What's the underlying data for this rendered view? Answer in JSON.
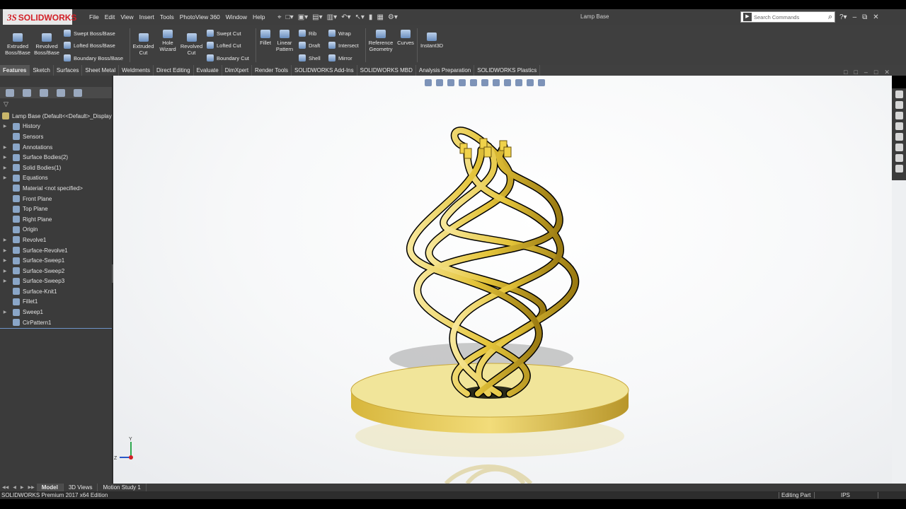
{
  "app": {
    "logo_ds": "3S",
    "logo_text": "SOLIDWORKS",
    "document_title": "Lamp Base"
  },
  "menu": [
    "File",
    "Edit",
    "View",
    "Insert",
    "Tools",
    "PhotoView 360",
    "Window",
    "Help"
  ],
  "search": {
    "placeholder": "Search Commands"
  },
  "ribbon": {
    "extruded_boss": "Extruded Boss/Base",
    "revolved_boss": "Revolved Boss/Base",
    "swept_boss": "Swept Boss/Base",
    "lofted_boss": "Lofted Boss/Base",
    "boundary_boss": "Boundary Boss/Base",
    "extruded_cut": "Extruded Cut",
    "hole_wizard": "Hole Wizard",
    "revolved_cut": "Revolved Cut",
    "swept_cut": "Swept Cut",
    "lofted_cut": "Lofted Cut",
    "boundary_cut": "Boundary Cut",
    "fillet": "Fillet",
    "linear_pattern": "Linear Pattern",
    "rib": "Rib",
    "draft": "Draft",
    "shell": "Shell",
    "wrap": "Wrap",
    "intersect": "Intersect",
    "mirror": "Mirror",
    "reference_geometry": "Reference Geometry",
    "curves": "Curves",
    "instant3d": "Instant3D"
  },
  "command_tabs": [
    "Features",
    "Sketch",
    "Surfaces",
    "Sheet Metal",
    "Weldments",
    "Direct Editing",
    "Evaluate",
    "DimXpert",
    "Render Tools",
    "SOLIDWORKS Add-Ins",
    "SOLIDWORKS MBD",
    "Analysis Preparation",
    "SOLIDWORKS Plastics"
  ],
  "tree": {
    "root": "Lamp Base  (Default<<Default>_Display",
    "items": [
      {
        "label": "History",
        "expandable": true,
        "icon": "history-icon"
      },
      {
        "label": "Sensors",
        "expandable": false,
        "icon": "sensor-icon"
      },
      {
        "label": "Annotations",
        "expandable": true,
        "icon": "annotation-icon"
      },
      {
        "label": "Surface Bodies(2)",
        "expandable": true,
        "icon": "surface-bodies-icon"
      },
      {
        "label": "Solid Bodies(1)",
        "expandable": true,
        "icon": "solid-bodies-icon"
      },
      {
        "label": "Equations",
        "expandable": true,
        "icon": "equations-icon"
      },
      {
        "label": "Material <not specified>",
        "expandable": false,
        "icon": "material-icon"
      },
      {
        "label": "Front Plane",
        "expandable": false,
        "icon": "plane-icon"
      },
      {
        "label": "Top Plane",
        "expandable": false,
        "icon": "plane-icon"
      },
      {
        "label": "Right Plane",
        "expandable": false,
        "icon": "plane-icon"
      },
      {
        "label": "Origin",
        "expandable": false,
        "icon": "origin-icon"
      },
      {
        "label": "Revolve1",
        "expandable": true,
        "icon": "revolve-icon"
      },
      {
        "label": "Surface-Revolve1",
        "expandable": true,
        "icon": "surface-revolve-icon"
      },
      {
        "label": "Surface-Sweep1",
        "expandable": true,
        "icon": "surface-sweep-icon"
      },
      {
        "label": "Surface-Sweep2",
        "expandable": true,
        "icon": "surface-sweep-icon"
      },
      {
        "label": "Surface-Sweep3",
        "expandable": true,
        "icon": "surface-sweep-icon"
      },
      {
        "label": "Surface-Knit1",
        "expandable": false,
        "icon": "surface-knit-icon"
      },
      {
        "label": "Fillet1",
        "expandable": false,
        "icon": "fillet-icon"
      },
      {
        "label": "Sweep1",
        "expandable": true,
        "icon": "sweep-icon"
      },
      {
        "label": "CirPattern1",
        "expandable": false,
        "icon": "circular-pattern-icon"
      }
    ]
  },
  "bottom_tabs": [
    "Model",
    "3D Views",
    "Motion Study 1"
  ],
  "status": {
    "edition": "SOLIDWORKS Premium 2017 x64 Edition",
    "mode": "Editing Part",
    "units": "IPS"
  },
  "triad": {
    "x": "X",
    "y": "Y",
    "z": "Z"
  },
  "colors": {
    "accent": "#d21f26",
    "model_gold": "#e4c43a",
    "base_fill": "#f1e59a",
    "tree_selection_line": "#6f93c8"
  }
}
